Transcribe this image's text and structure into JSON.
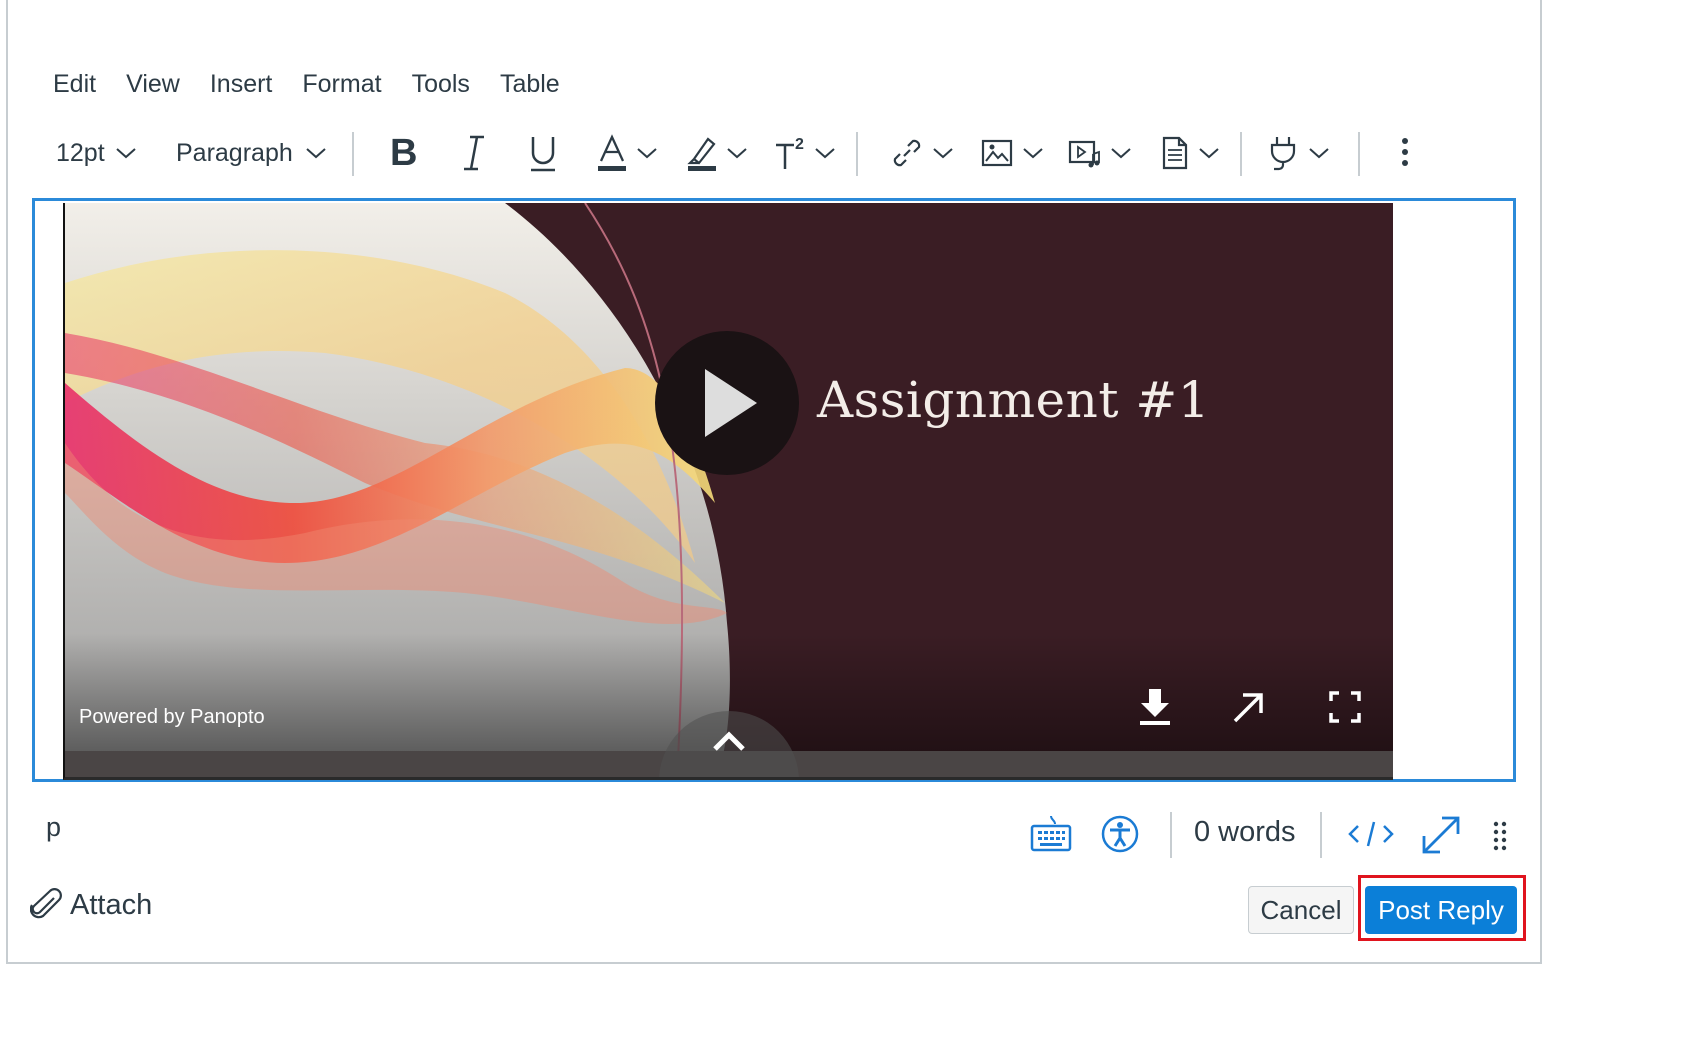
{
  "menubar": {
    "items": [
      "Edit",
      "View",
      "Insert",
      "Format",
      "Tools",
      "Table"
    ]
  },
  "toolbar": {
    "font_size": "12pt",
    "block_format": "Paragraph",
    "icons": [
      "bold-icon",
      "italic-icon",
      "underline-icon",
      "text-color-icon",
      "highlight-icon",
      "superscript-icon",
      "link-icon",
      "image-icon",
      "media-icon",
      "document-icon",
      "plugin-icon",
      "more-icon"
    ]
  },
  "video": {
    "title": "Assignment #1",
    "powered_by": "Powered by Panopto",
    "colors": {
      "background": "#3a1d24",
      "accent_red": "#e8303a",
      "accent_yellow": "#f3d36a"
    }
  },
  "statusbar": {
    "path": "p",
    "word_count": "0 words"
  },
  "actions": {
    "attach_label": "Attach",
    "cancel_label": "Cancel",
    "post_label": "Post Reply"
  },
  "colors": {
    "focus_border": "#2b8ad9",
    "primary_button": "#0b7fd8",
    "highlight_box": "#e0141e",
    "icon_blue": "#1b7bd4"
  }
}
